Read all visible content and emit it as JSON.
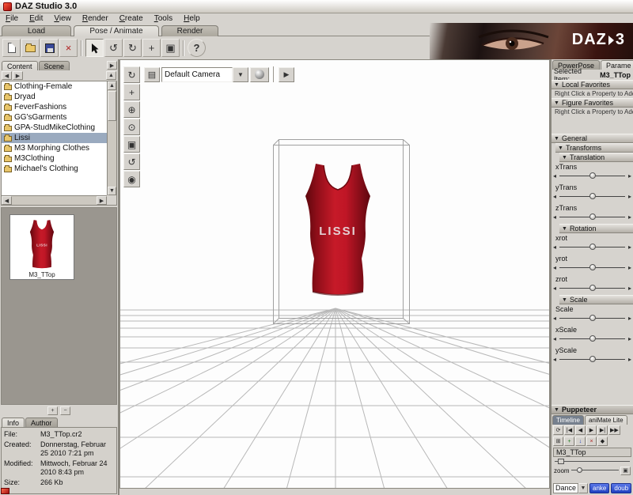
{
  "window": {
    "title": "DAZ Studio 3.0"
  },
  "menubar": {
    "items": [
      "File",
      "Edit",
      "View",
      "Render",
      "Create",
      "Tools",
      "Help"
    ]
  },
  "main_tabs": {
    "load": "Load",
    "pose_animate": "Pose / Animate",
    "render": "Render"
  },
  "banner": {
    "logo": "DAZ",
    "num": "3"
  },
  "icons": {
    "collapse": "▼",
    "left": "◀",
    "right": "▶",
    "up": "▲",
    "down": "▼",
    "tri_left": "◂",
    "tri_right": "▸",
    "delete": "×",
    "help": "?",
    "rotate": "↺",
    "orbit": "↻",
    "translate": "+",
    "frame": "▣",
    "camera": "▤",
    "play": "▶",
    "pan": "+",
    "zoom": "⊕",
    "dolly": "⊙",
    "aim": "◉",
    "home": "⌂",
    "loop": "⟳",
    "first": "|◀",
    "prev": "◀",
    "next": "▶▶",
    "last": "▶|",
    "grid": "⊞",
    "plus": "+",
    "minus": "−",
    "arrow_down": "↓",
    "diamond": "◆",
    "stop_x": "×"
  },
  "toolbar": {
    "buttons": [
      "new",
      "open",
      "save",
      "delete",
      "pointer",
      "rotate",
      "orbit",
      "translate",
      "scale",
      "help"
    ]
  },
  "left_panel": {
    "tabs": {
      "content": "Content",
      "scene": "Scene"
    },
    "tree": [
      "Clothing-Female",
      "Dryad",
      "FeverFashions",
      "GG'sGarments",
      "GPA-StudMikeClothing",
      "Lissi",
      "M3 Morphing Clothes",
      "M3Clothing",
      "Michael's Clothing"
    ],
    "selected_item": "Lissi",
    "thumbnail": {
      "label": "M3_TTop"
    },
    "bottom_tabs": {
      "info": "Info",
      "author": "Author"
    },
    "info": {
      "file_label": "File:",
      "file": "M3_TTop.cr2",
      "created_label": "Created:",
      "created": "Donnerstag, Februar 25 2010 7:21 pm",
      "modified_label": "Modified:",
      "modified": "Mittwoch, Februar 24 2010 8:43 pm",
      "size_label": "Size:",
      "size": "266 Kb"
    }
  },
  "viewport": {
    "camera": "Default Camera",
    "model_text": "LISSI"
  },
  "right_panel": {
    "tabs": {
      "powerpose": "PowerPose",
      "parameters": "Parame"
    },
    "selected_item_label": "Selected Item:",
    "selected_item": "M3_TTop",
    "favorites_hint": "Right Click a Property to Add it",
    "sections": {
      "local_favorites": "Local Favorites",
      "figure_favorites": "Figure Favorites",
      "general": "General",
      "transforms": "Transforms",
      "translation": "Translation",
      "rotation": "Rotation",
      "scale": "Scale",
      "puppeteer": "Puppeteer"
    },
    "translation": {
      "items": [
        "xTrans",
        "yTrans",
        "zTrans"
      ]
    },
    "rotation": {
      "items": [
        "xrot",
        "yrot",
        "zrot"
      ]
    },
    "scale": {
      "items": [
        "Scale",
        "xScale",
        "yScale"
      ]
    }
  },
  "animate": {
    "tabs": {
      "timeline": "Timeline",
      "animate_lite": "aniMate Lite"
    },
    "item": "M3_TTop",
    "zoom_label": "zoom",
    "dance": "Dance",
    "buttons": {
      "b1": "anke",
      "b2": "doub"
    }
  }
}
